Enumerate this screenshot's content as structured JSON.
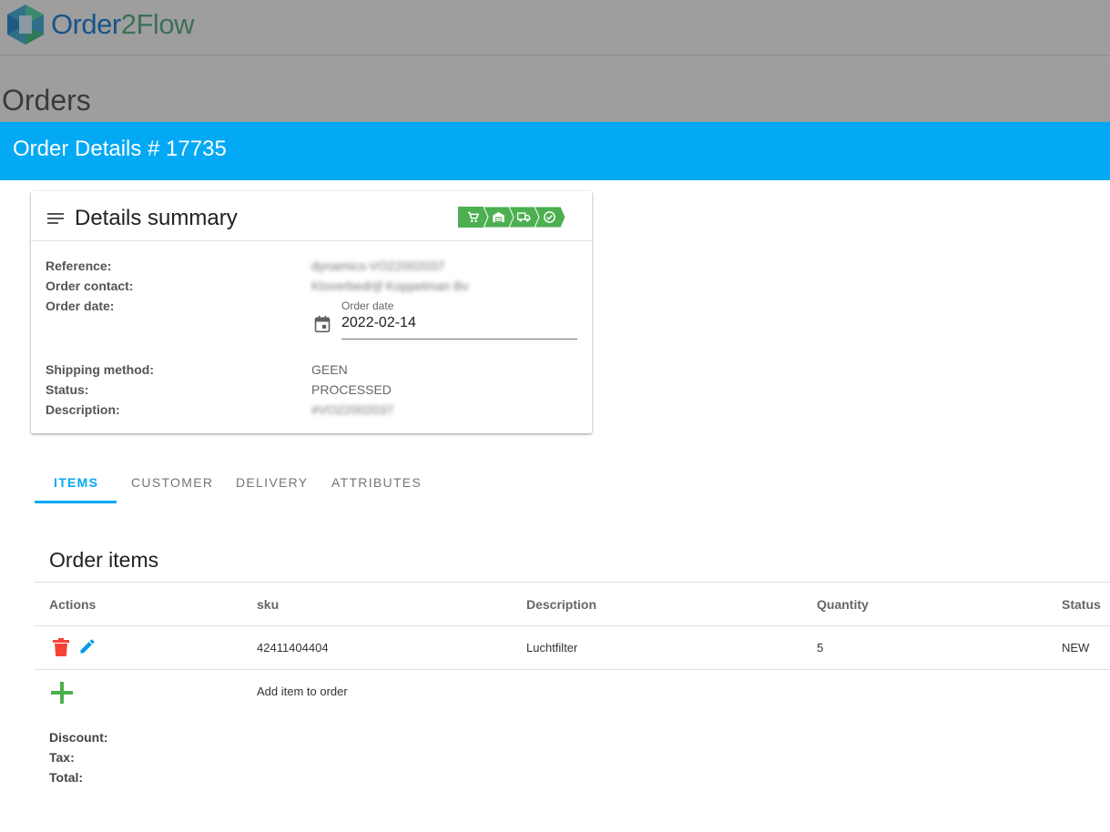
{
  "app": {
    "logo_part1": "Order",
    "logo_part2": "2",
    "logo_part3": "Flow",
    "page_title": "Orders"
  },
  "modal": {
    "title": "Order Details # 17735"
  },
  "summary": {
    "title": "Details summary",
    "steps": [
      "cart-icon",
      "warehouse-icon",
      "truck-icon",
      "check-circle-icon"
    ],
    "step_color": "#4caf50",
    "reference_label": "Reference:",
    "reference_value": "dynamics-VO22002037",
    "contact_label": "Order contact:",
    "contact_value": "Kloverbedrijf Koppelman Bv",
    "date_label": "Order date:",
    "date_field_label": "Order date",
    "date_value": "2022-02-14",
    "shipping_label": "Shipping method:",
    "shipping_value": "GEEN",
    "status_label": "Status:",
    "status_value": "PROCESSED",
    "description_label": "Description:",
    "description_value": "#VO22002037"
  },
  "tabs": [
    "ITEMS",
    "CUSTOMER",
    "DELIVERY",
    "ATTRIBUTES"
  ],
  "items": {
    "title": "Order items",
    "columns": [
      "Actions",
      "sku",
      "Description",
      "Quantity",
      "Status"
    ],
    "rows": [
      {
        "sku": "42411404404",
        "description": "Luchtfilter",
        "quantity": "5",
        "status": "NEW"
      }
    ],
    "add_label": "Add item to order",
    "discount_label": "Discount:",
    "tax_label": "Tax:",
    "total_label": "Total:"
  },
  "colors": {
    "accent": "#03a9f4",
    "delete": "#f44336",
    "edit": "#039be5",
    "add": "#4caf50"
  }
}
